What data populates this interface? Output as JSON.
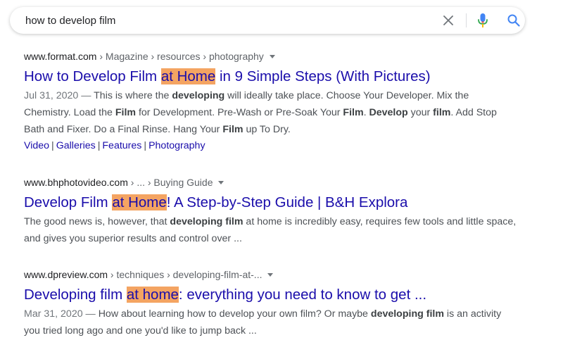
{
  "search": {
    "query": "how to develop film"
  },
  "icons": {
    "clear": "close-icon",
    "mic": "microphone-icon",
    "search": "search-icon"
  },
  "colors": {
    "link": "#1a0dab",
    "highlight": "#f4a462",
    "snippet_text": "#4d5156",
    "mic_blue": "#4285f4",
    "mic_red": "#ea4335",
    "search_blue": "#4285f4"
  },
  "results": [
    {
      "domain": "www.format.com",
      "path": " › Magazine › resources › photography",
      "title_pre": "How to Develop Film ",
      "title_hl": "at Home",
      "title_post": " in 9 Simple Steps (With Pictures)",
      "date": "Jul 31, 2020",
      "dash": " — ",
      "snippet": [
        {
          "t": "This is where the "
        },
        {
          "t": "developing",
          "b": true
        },
        {
          "t": " will ideally take place. Choose Your Developer. Mix the Chemistry. Load the "
        },
        {
          "t": "Film",
          "b": true
        },
        {
          "t": " for Development. Pre-Wash or Pre-Soak Your "
        },
        {
          "t": "Film",
          "b": true
        },
        {
          "t": ". "
        },
        {
          "t": "Develop",
          "b": true
        },
        {
          "t": " your "
        },
        {
          "t": "film",
          "b": true
        },
        {
          "t": ". Add Stop Bath and Fixer. Do a Final Rinse. Hang Your "
        },
        {
          "t": "Film",
          "b": true
        },
        {
          "t": " up To Dry."
        }
      ],
      "sitelinks": [
        "Video",
        "Galleries",
        "Features",
        "Photography"
      ],
      "sitelink_sep": "|"
    },
    {
      "domain": "www.bhphotovideo.com",
      "path": " › ... › Buying Guide",
      "title_pre": "Develop Film ",
      "title_hl": "at Home",
      "title_post": "! A Step-by-Step Guide | B&H Explora",
      "snippet": [
        {
          "t": "The good news is, however, that "
        },
        {
          "t": "developing film",
          "b": true
        },
        {
          "t": " at home is incredibly easy, requires few tools and little space, and gives you superior results and control over ..."
        }
      ]
    },
    {
      "domain": "www.dpreview.com",
      "path": " › techniques › developing-film-at-...",
      "title_pre": "Developing film ",
      "title_hl": "at home",
      "title_post": ": everything you need to know to get ...",
      "date": "Mar 31, 2020",
      "dash": " — ",
      "snippet": [
        {
          "t": "How about learning how to develop your own film? Or maybe "
        },
        {
          "t": "developing film",
          "b": true
        },
        {
          "t": " is an activity you tried long ago and one you'd like to jump back ..."
        }
      ]
    }
  ]
}
